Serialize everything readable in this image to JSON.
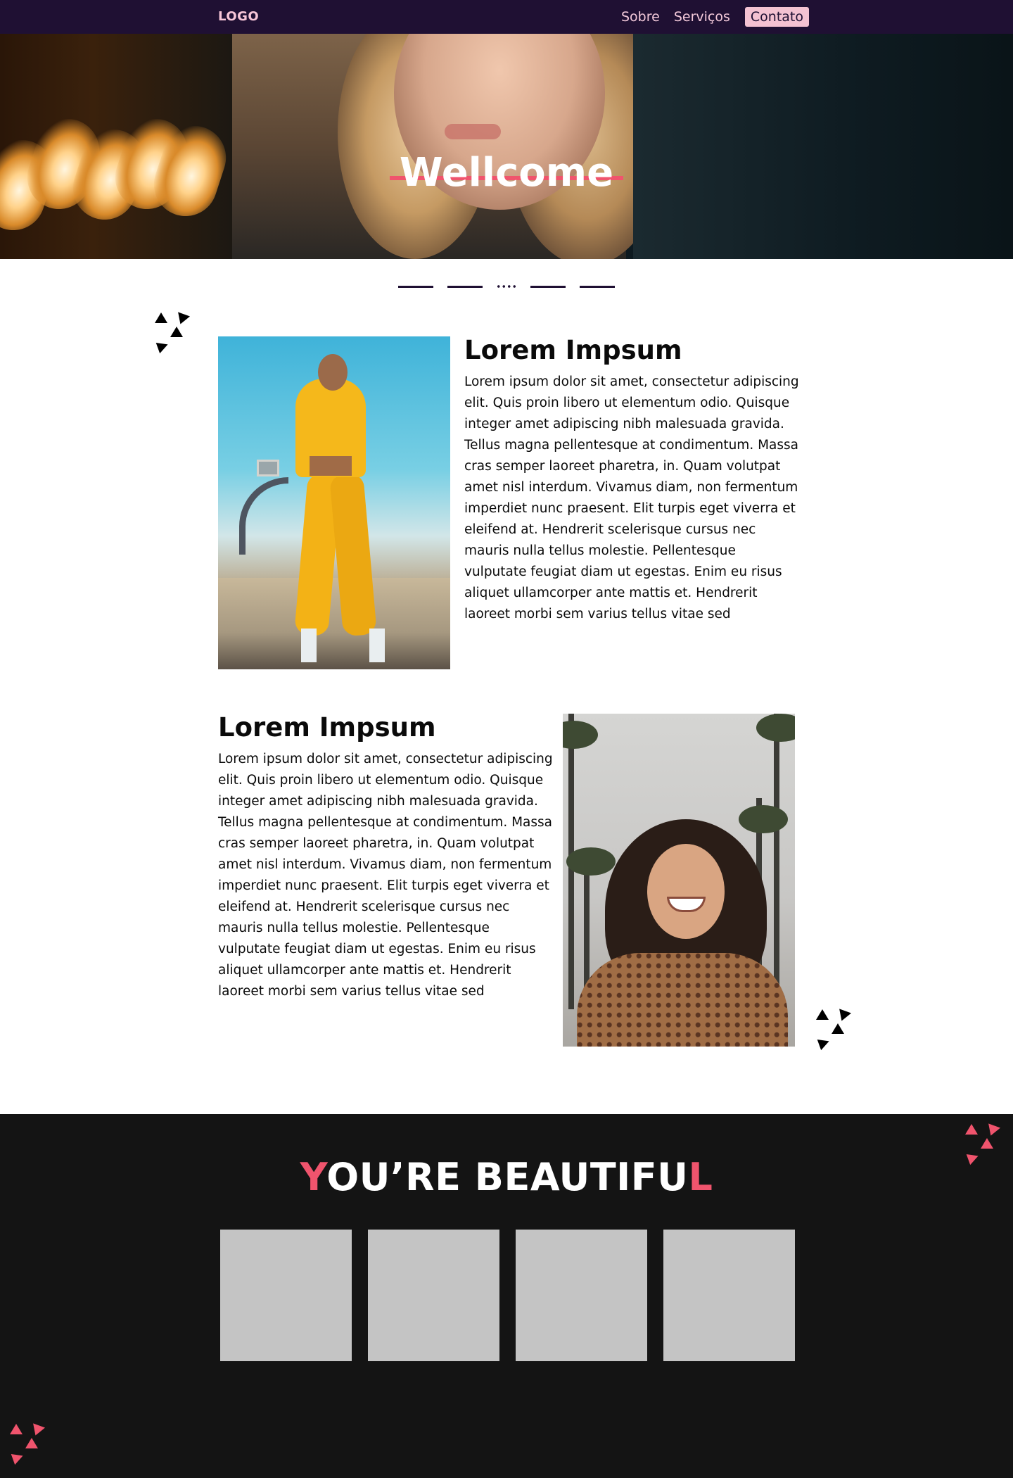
{
  "nav": {
    "logo": "LOGO",
    "links": [
      {
        "label": "Sobre"
      },
      {
        "label": "Serviços"
      },
      {
        "label": "Contato"
      }
    ]
  },
  "hero": {
    "title": "Wellcome"
  },
  "slider": {
    "indicators": [
      "dash",
      "dash",
      "dots",
      "dash",
      "dash"
    ]
  },
  "features": [
    {
      "title": "Lorem Impsum",
      "text": "Lorem ipsum dolor sit amet, consectetur adipiscing elit. Quis proin libero ut elementum odio. Quisque integer amet adipiscing nibh malesuada gravida. Tellus magna pellentesque at condimentum. Massa cras semper laoreet pharetra, in. Quam volutpat amet nisl interdum. Vivamus diam, non fermentum imperdiet nunc praesent. Elit turpis eget viverra et eleifend at. Hendrerit scelerisque cursus nec mauris nulla tellus molestie. Pellentesque vulputate feugiat diam ut egestas. Enim eu risus aliquet ullamcorper ante mattis et. Hendrerit laoreet morbi sem varius tellus vitae sed"
    },
    {
      "title": "Lorem Impsum",
      "text": "Lorem ipsum dolor sit amet, consectetur adipiscing elit. Quis proin libero ut elementum odio. Quisque integer amet adipiscing nibh malesuada gravida. Tellus magna pellentesque at condimentum. Massa cras semper laoreet pharetra, in. Quam volutpat amet nisl interdum. Vivamus diam, non fermentum imperdiet nunc praesent. Elit turpis eget viverra et eleifend at. Hendrerit scelerisque cursus nec mauris nulla tellus molestie. Pellentesque vulputate feugiat diam ut egestas. Enim eu risus aliquet ullamcorper ante mattis et. Hendrerit laoreet morbi sem varius tellus vitae sed"
    }
  ],
  "beautiful": {
    "first_letter": "Y",
    "middle": "OU’RE BEAUTIFU",
    "last_letter": "L",
    "tiles": 4
  },
  "colors": {
    "nav_bg": "#1f1033",
    "accent": "#f0546d",
    "nav_text": "#f3c9da",
    "dark_bg": "#141414",
    "tile": "#c4c4c4"
  },
  "icons": [
    "triangle-cluster-icon"
  ]
}
